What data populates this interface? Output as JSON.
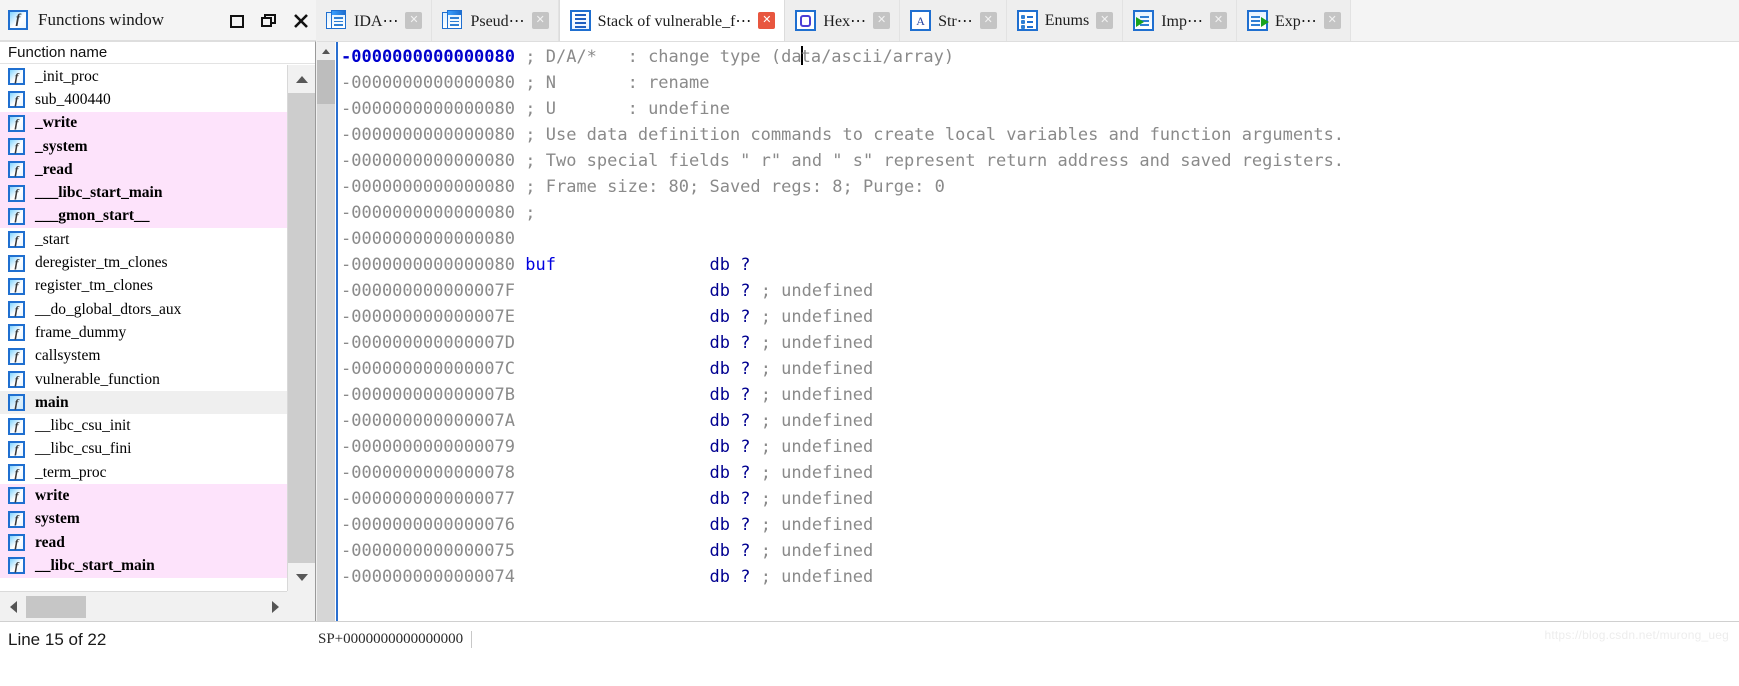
{
  "window": {
    "title": "Functions window",
    "icon": "function-f-icon",
    "buttons": [
      {
        "name": "restore-button",
        "glyph": "☐"
      },
      {
        "name": "maximize-button",
        "glyph": "❐"
      },
      {
        "name": "close-button",
        "glyph": "✕"
      }
    ]
  },
  "tabs": [
    {
      "label": "IDA⋯",
      "icon": "ida-view-icon",
      "active": false,
      "close": "✕"
    },
    {
      "label": "Pseud⋯",
      "icon": "pseudocode-icon",
      "active": false,
      "close": "✕"
    },
    {
      "label": "Stack of vulnerable_f⋯",
      "icon": "stack-frame-icon",
      "active": true,
      "close": "✕"
    },
    {
      "label": "Hex⋯",
      "icon": "hex-view-icon",
      "active": false,
      "close": "✕"
    },
    {
      "label": "Str⋯",
      "icon": "strings-icon",
      "active": false,
      "close": "✕"
    },
    {
      "label": "Enums",
      "icon": "enums-icon",
      "active": false,
      "close": "✕"
    },
    {
      "label": "Imp⋯",
      "icon": "imports-icon",
      "active": false,
      "close": "✕"
    },
    {
      "label": "Exp⋯",
      "icon": "exports-icon",
      "active": false,
      "close": "✕"
    }
  ],
  "functions_panel": {
    "column_header": "Function name",
    "rows": [
      {
        "name": "_init_proc",
        "style": "normal"
      },
      {
        "name": "sub_400440",
        "style": "normal"
      },
      {
        "name": "_write",
        "style": "library"
      },
      {
        "name": "_system",
        "style": "library"
      },
      {
        "name": "_read",
        "style": "library"
      },
      {
        "name": "___libc_start_main",
        "style": "library"
      },
      {
        "name": "___gmon_start__",
        "style": "library"
      },
      {
        "name": "_start",
        "style": "normal"
      },
      {
        "name": "deregister_tm_clones",
        "style": "normal"
      },
      {
        "name": "register_tm_clones",
        "style": "normal"
      },
      {
        "name": "__do_global_dtors_aux",
        "style": "normal"
      },
      {
        "name": "frame_dummy",
        "style": "normal"
      },
      {
        "name": "callsystem",
        "style": "normal"
      },
      {
        "name": "vulnerable_function",
        "style": "normal"
      },
      {
        "name": "main",
        "style": "selected"
      },
      {
        "name": "__libc_csu_init",
        "style": "normal"
      },
      {
        "name": "__libc_csu_fini",
        "style": "normal"
      },
      {
        "name": "_term_proc",
        "style": "normal"
      },
      {
        "name": "write",
        "style": "library"
      },
      {
        "name": "system",
        "style": "library"
      },
      {
        "name": "read",
        "style": "library"
      },
      {
        "name": "__libc_start_main",
        "style": "library"
      }
    ]
  },
  "stack_view": {
    "lines": [
      {
        "addr": "-0000000000000080",
        "current": true,
        "body": "; D/A/*   : change type (data/ascii/array)",
        "kind": "comment",
        "caret_after": "; D/A/*   : change type (da"
      },
      {
        "addr": "-0000000000000080",
        "current": false,
        "body": "; N       : rename",
        "kind": "comment"
      },
      {
        "addr": "-0000000000000080",
        "current": false,
        "body": "; U       : undefine",
        "kind": "comment"
      },
      {
        "addr": "-0000000000000080",
        "current": false,
        "body": "; Use data definition commands to create local variables and function arguments.",
        "kind": "comment"
      },
      {
        "addr": "-0000000000000080",
        "current": false,
        "body": "; Two special fields \" r\" and \" s\" represent return address and saved registers.",
        "kind": "comment"
      },
      {
        "addr": "-0000000000000080",
        "current": false,
        "body": "; Frame size: 80; Saved regs: 8; Purge: 0",
        "kind": "comment"
      },
      {
        "addr": "-0000000000000080",
        "current": false,
        "body": ";",
        "kind": "comment"
      },
      {
        "addr": "-0000000000000080",
        "current": false,
        "body": "",
        "kind": "blank"
      },
      {
        "addr": "-0000000000000080",
        "current": false,
        "kind": "data",
        "label": "buf",
        "decl": "db ?",
        "comment": ""
      },
      {
        "addr": "-000000000000007F",
        "current": false,
        "kind": "data",
        "label": "",
        "decl": "db ?",
        "comment": "; undefined"
      },
      {
        "addr": "-000000000000007E",
        "current": false,
        "kind": "data",
        "label": "",
        "decl": "db ?",
        "comment": "; undefined"
      },
      {
        "addr": "-000000000000007D",
        "current": false,
        "kind": "data",
        "label": "",
        "decl": "db ?",
        "comment": "; undefined"
      },
      {
        "addr": "-000000000000007C",
        "current": false,
        "kind": "data",
        "label": "",
        "decl": "db ?",
        "comment": "; undefined"
      },
      {
        "addr": "-000000000000007B",
        "current": false,
        "kind": "data",
        "label": "",
        "decl": "db ?",
        "comment": "; undefined"
      },
      {
        "addr": "-000000000000007A",
        "current": false,
        "kind": "data",
        "label": "",
        "decl": "db ?",
        "comment": "; undefined"
      },
      {
        "addr": "-0000000000000079",
        "current": false,
        "kind": "data",
        "label": "",
        "decl": "db ?",
        "comment": "; undefined"
      },
      {
        "addr": "-0000000000000078",
        "current": false,
        "kind": "data",
        "label": "",
        "decl": "db ?",
        "comment": "; undefined"
      },
      {
        "addr": "-0000000000000077",
        "current": false,
        "kind": "data",
        "label": "",
        "decl": "db ?",
        "comment": "; undefined"
      },
      {
        "addr": "-0000000000000076",
        "current": false,
        "kind": "data",
        "label": "",
        "decl": "db ?",
        "comment": "; undefined"
      },
      {
        "addr": "-0000000000000075",
        "current": false,
        "kind": "data",
        "label": "",
        "decl": "db ?",
        "comment": "; undefined"
      },
      {
        "addr": "-0000000000000074",
        "current": false,
        "kind": "data",
        "label": "",
        "decl": "db ?",
        "comment": "; undefined"
      }
    ]
  },
  "statusbar": {
    "line_info": "Line 15 of 22",
    "sp_value": "SP+0000000000000000",
    "watermark": "https://blog.csdn.net/murong_ueg"
  },
  "colors": {
    "library_row_bg": "#fde3fb",
    "selected_row_bg": "#efefef",
    "current_addr": "#0000cd",
    "name_blue": "#0000e0",
    "keyword_navy": "#000090",
    "comment_gray": "#8a8a8a",
    "active_tab_close": "#e8563f"
  }
}
